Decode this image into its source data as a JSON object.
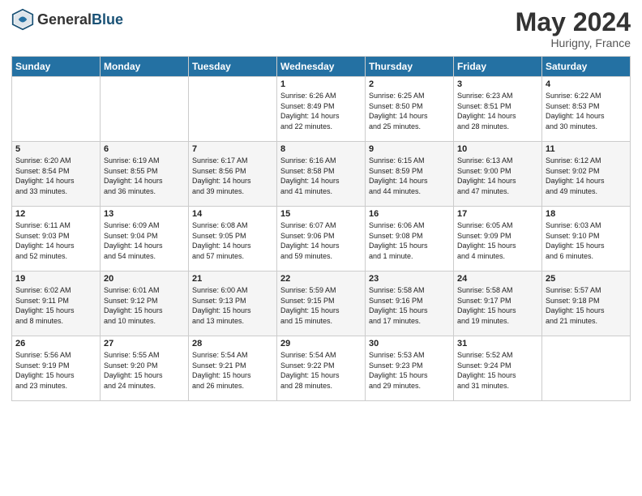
{
  "header": {
    "logo_general": "General",
    "logo_blue": "Blue",
    "month_year": "May 2024",
    "location": "Hurigny, France"
  },
  "weekdays": [
    "Sunday",
    "Monday",
    "Tuesday",
    "Wednesday",
    "Thursday",
    "Friday",
    "Saturday"
  ],
  "weeks": [
    [
      {
        "day": "",
        "info": ""
      },
      {
        "day": "",
        "info": ""
      },
      {
        "day": "",
        "info": ""
      },
      {
        "day": "1",
        "info": "Sunrise: 6:26 AM\nSunset: 8:49 PM\nDaylight: 14 hours\nand 22 minutes."
      },
      {
        "day": "2",
        "info": "Sunrise: 6:25 AM\nSunset: 8:50 PM\nDaylight: 14 hours\nand 25 minutes."
      },
      {
        "day": "3",
        "info": "Sunrise: 6:23 AM\nSunset: 8:51 PM\nDaylight: 14 hours\nand 28 minutes."
      },
      {
        "day": "4",
        "info": "Sunrise: 6:22 AM\nSunset: 8:53 PM\nDaylight: 14 hours\nand 30 minutes."
      }
    ],
    [
      {
        "day": "5",
        "info": "Sunrise: 6:20 AM\nSunset: 8:54 PM\nDaylight: 14 hours\nand 33 minutes."
      },
      {
        "day": "6",
        "info": "Sunrise: 6:19 AM\nSunset: 8:55 PM\nDaylight: 14 hours\nand 36 minutes."
      },
      {
        "day": "7",
        "info": "Sunrise: 6:17 AM\nSunset: 8:56 PM\nDaylight: 14 hours\nand 39 minutes."
      },
      {
        "day": "8",
        "info": "Sunrise: 6:16 AM\nSunset: 8:58 PM\nDaylight: 14 hours\nand 41 minutes."
      },
      {
        "day": "9",
        "info": "Sunrise: 6:15 AM\nSunset: 8:59 PM\nDaylight: 14 hours\nand 44 minutes."
      },
      {
        "day": "10",
        "info": "Sunrise: 6:13 AM\nSunset: 9:00 PM\nDaylight: 14 hours\nand 47 minutes."
      },
      {
        "day": "11",
        "info": "Sunrise: 6:12 AM\nSunset: 9:02 PM\nDaylight: 14 hours\nand 49 minutes."
      }
    ],
    [
      {
        "day": "12",
        "info": "Sunrise: 6:11 AM\nSunset: 9:03 PM\nDaylight: 14 hours\nand 52 minutes."
      },
      {
        "day": "13",
        "info": "Sunrise: 6:09 AM\nSunset: 9:04 PM\nDaylight: 14 hours\nand 54 minutes."
      },
      {
        "day": "14",
        "info": "Sunrise: 6:08 AM\nSunset: 9:05 PM\nDaylight: 14 hours\nand 57 minutes."
      },
      {
        "day": "15",
        "info": "Sunrise: 6:07 AM\nSunset: 9:06 PM\nDaylight: 14 hours\nand 59 minutes."
      },
      {
        "day": "16",
        "info": "Sunrise: 6:06 AM\nSunset: 9:08 PM\nDaylight: 15 hours\nand 1 minute."
      },
      {
        "day": "17",
        "info": "Sunrise: 6:05 AM\nSunset: 9:09 PM\nDaylight: 15 hours\nand 4 minutes."
      },
      {
        "day": "18",
        "info": "Sunrise: 6:03 AM\nSunset: 9:10 PM\nDaylight: 15 hours\nand 6 minutes."
      }
    ],
    [
      {
        "day": "19",
        "info": "Sunrise: 6:02 AM\nSunset: 9:11 PM\nDaylight: 15 hours\nand 8 minutes."
      },
      {
        "day": "20",
        "info": "Sunrise: 6:01 AM\nSunset: 9:12 PM\nDaylight: 15 hours\nand 10 minutes."
      },
      {
        "day": "21",
        "info": "Sunrise: 6:00 AM\nSunset: 9:13 PM\nDaylight: 15 hours\nand 13 minutes."
      },
      {
        "day": "22",
        "info": "Sunrise: 5:59 AM\nSunset: 9:15 PM\nDaylight: 15 hours\nand 15 minutes."
      },
      {
        "day": "23",
        "info": "Sunrise: 5:58 AM\nSunset: 9:16 PM\nDaylight: 15 hours\nand 17 minutes."
      },
      {
        "day": "24",
        "info": "Sunrise: 5:58 AM\nSunset: 9:17 PM\nDaylight: 15 hours\nand 19 minutes."
      },
      {
        "day": "25",
        "info": "Sunrise: 5:57 AM\nSunset: 9:18 PM\nDaylight: 15 hours\nand 21 minutes."
      }
    ],
    [
      {
        "day": "26",
        "info": "Sunrise: 5:56 AM\nSunset: 9:19 PM\nDaylight: 15 hours\nand 23 minutes."
      },
      {
        "day": "27",
        "info": "Sunrise: 5:55 AM\nSunset: 9:20 PM\nDaylight: 15 hours\nand 24 minutes."
      },
      {
        "day": "28",
        "info": "Sunrise: 5:54 AM\nSunset: 9:21 PM\nDaylight: 15 hours\nand 26 minutes."
      },
      {
        "day": "29",
        "info": "Sunrise: 5:54 AM\nSunset: 9:22 PM\nDaylight: 15 hours\nand 28 minutes."
      },
      {
        "day": "30",
        "info": "Sunrise: 5:53 AM\nSunset: 9:23 PM\nDaylight: 15 hours\nand 29 minutes."
      },
      {
        "day": "31",
        "info": "Sunrise: 5:52 AM\nSunset: 9:24 PM\nDaylight: 15 hours\nand 31 minutes."
      },
      {
        "day": "",
        "info": ""
      }
    ]
  ]
}
